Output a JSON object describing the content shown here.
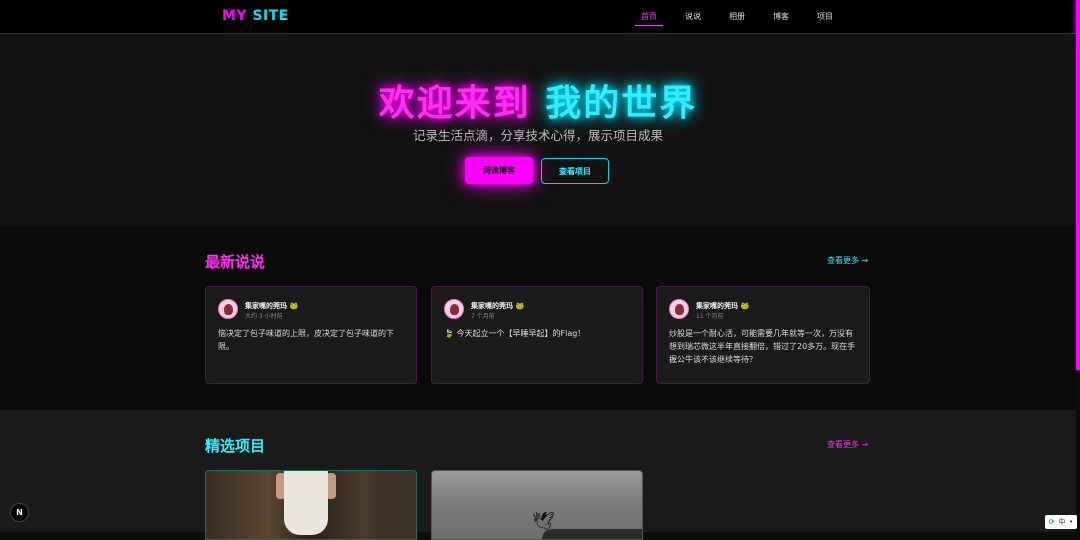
{
  "nav": {
    "logo_a": "MY",
    "logo_b": "SITE",
    "links": [
      "首页",
      "说说",
      "相册",
      "博客",
      "项目"
    ]
  },
  "hero": {
    "title_a": "欢迎来到",
    "title_b": "我的世界",
    "subtitle": "记录生活点滴，分享技术心得，展示项目成果",
    "btn_primary": "阅读博客",
    "btn_secondary": "查看项目"
  },
  "moments": {
    "title": "最新说说",
    "more": "查看更多 →",
    "items": [
      {
        "user": "集家嘴的莞玛",
        "time": "大约 3 小时前",
        "text": "恼决定了包子味道的上限，皮决定了包子味道的下限。"
      },
      {
        "user": "集家嘴的莞玛",
        "time": "7 个月前",
        "text": "🍃 今天起立一个【早睡早起】的Flag！"
      },
      {
        "user": "集家嘴的莞玛",
        "time": "11 个月前",
        "text": "炒股是一个耐心活，可能需要几年就等一次，万没有想到瑞芯微这半年直接翻倍，错过了20多万。现在手握公牛该不该继续等待？"
      }
    ]
  },
  "projects": {
    "title": "精选项目",
    "more": "查看更多 →"
  },
  "misc": {
    "next_badge": "N",
    "ime_lang": "中",
    "ime_dot": "•"
  },
  "colors": {
    "magenta": "#ff00ff",
    "cyan": "#00e5ff",
    "background": "#0d0d0d"
  }
}
